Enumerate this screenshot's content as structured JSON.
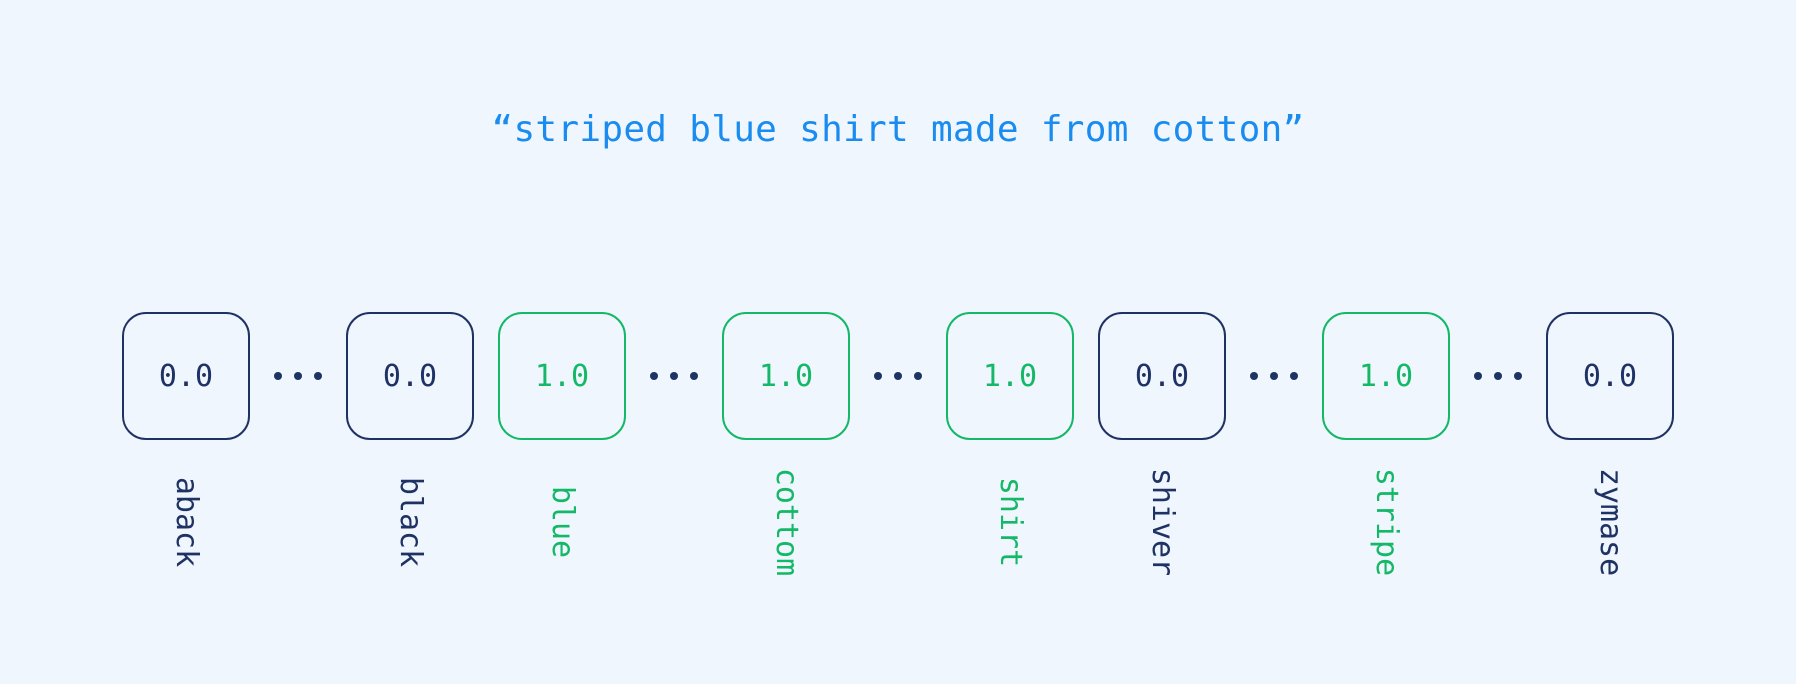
{
  "title": "“striped blue shirt made from cotton”",
  "colors": {
    "background": "#f0f6fe",
    "title": "#1a8cf0",
    "inactive": "#1f3264",
    "active": "#14b866"
  },
  "vector": [
    {
      "word": "aback",
      "value": "0.0",
      "active": false
    },
    {
      "word": "black",
      "value": "0.0",
      "active": false
    },
    {
      "word": "blue",
      "value": "1.0",
      "active": true
    },
    {
      "word": "cottom",
      "value": "1.0",
      "active": true
    },
    {
      "word": "shirt",
      "value": "1.0",
      "active": true
    },
    {
      "word": "shiver",
      "value": "0.0",
      "active": false
    },
    {
      "word": "stripe",
      "value": "1.0",
      "active": true
    },
    {
      "word": "zymase",
      "value": "0.0",
      "active": false
    }
  ],
  "ellipsis_glyph": "ellipsis-icon"
}
